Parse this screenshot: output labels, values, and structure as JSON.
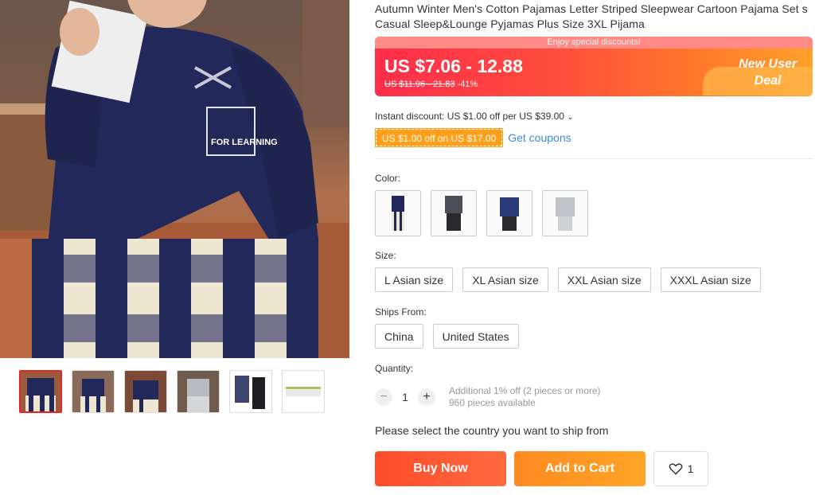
{
  "product": {
    "title": "Autumn Winter Men's Cotton Pajamas Letter Striped Sleepwear Cartoon Pajama Set s Casual Sleep&Lounge Pyjamas Plus Size 3XL Pijama",
    "main_image_text": "FOR LEARNING"
  },
  "price": {
    "banner_text": "Enjoy special discounts!",
    "current": "US $7.06 - 12.88",
    "original": "US $11.96 - 21.83",
    "discount": "-41%",
    "deal_line1": "New User",
    "deal_line2": "Deal"
  },
  "coupons": {
    "instant_discount": "Instant discount: US $1.00 off per US $39.00",
    "tag": "US $1.00 off on US $17.00",
    "get_coupons": "Get coupons"
  },
  "color": {
    "label": "Color:",
    "options": [
      "navy-top-plaid-pants",
      "grey-long-sleeve-dark-pants",
      "navy-top-dark-pants",
      "grey-top-grey-pants"
    ],
    "selected_index": 0
  },
  "size": {
    "label": "Size:",
    "options": [
      "L Asian size",
      "XL Asian size",
      "XXL Asian size",
      "XXXL Asian size"
    ]
  },
  "ships_from": {
    "label": "Ships From:",
    "options": [
      "China",
      "United States"
    ]
  },
  "quantity": {
    "label": "Quantity:",
    "value": "1",
    "minus": "−",
    "plus": "+",
    "promo": "Additional 1% off (2 pieces or more)",
    "available": "960 pieces available"
  },
  "ship_message": "Please select the country you want to ship from",
  "actions": {
    "buy_now": "Buy Now",
    "add_to_cart": "Add to Cart",
    "wishlist_count": "1"
  },
  "gallery": {
    "thumb_count": 6,
    "active_index": 0
  },
  "colors_theme": {
    "accent_red": "#ff4b2b",
    "accent_orange": "#ff9f1a",
    "link_blue": "#3a8bd1"
  }
}
